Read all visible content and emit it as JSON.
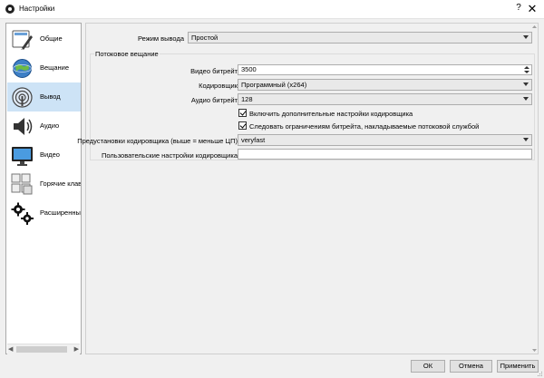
{
  "window": {
    "title": "Настройки",
    "help": "?",
    "close": "✕"
  },
  "sidebar": {
    "items": [
      {
        "label": "Общие",
        "icon": "general-settings-icon"
      },
      {
        "label": "Вещание",
        "icon": "broadcast-globe-icon"
      },
      {
        "label": "Вывод",
        "icon": "output-signal-icon",
        "active": true
      },
      {
        "label": "Аудио",
        "icon": "speaker-icon"
      },
      {
        "label": "Видео",
        "icon": "monitor-icon"
      },
      {
        "label": "Горячие клав",
        "icon": "hotkeys-keyboard-icon"
      },
      {
        "label": "Расширенны",
        "icon": "gears-icon"
      }
    ]
  },
  "output": {
    "mode_label": "Режим вывода",
    "mode_value": "Простой",
    "group_title": "Потоковое вещание",
    "video_bitrate_label": "Видео битрейт",
    "video_bitrate_value": "3500",
    "encoder_label": "Кодировщик",
    "encoder_value": "Программный (x264)",
    "audio_bitrate_label": "Аудио битрейт",
    "audio_bitrate_value": "128",
    "advanced_encoder_label": "Включить дополнительные настройки кодировщика",
    "enforce_bitrate_label": "Следовать ограничениям битрейта, накладываемые потоковой службой",
    "preset_label": "Предустановки кодировщика (выше = меньше ЦП)",
    "preset_value": "veryfast",
    "custom_settings_label": "Пользовательские настройки кодировщика",
    "custom_settings_value": ""
  },
  "buttons": {
    "ok": "ОК",
    "cancel": "Отмена",
    "apply": "Применить"
  },
  "colors": {
    "selection": "#cde3f6",
    "window_bg": "#f0f0f0"
  }
}
